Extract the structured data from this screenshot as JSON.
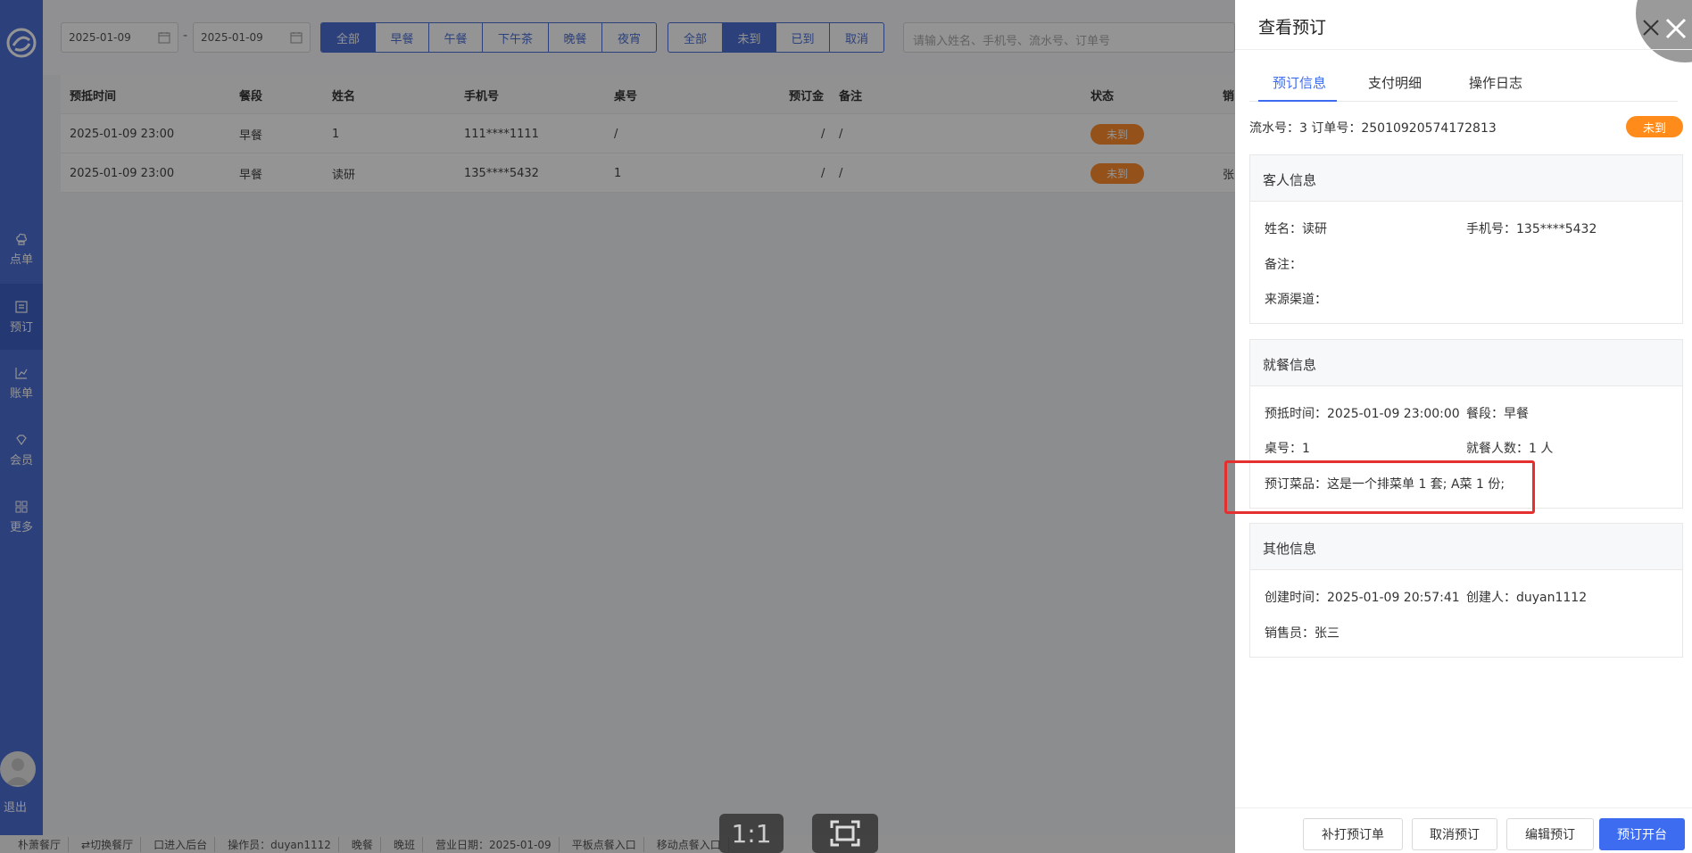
{
  "sidebar": {
    "items": [
      {
        "label": "点单",
        "icon": "chef-hat-icon"
      },
      {
        "label": "预订",
        "icon": "book-icon"
      },
      {
        "label": "账单",
        "icon": "chart-icon"
      },
      {
        "label": "会员",
        "icon": "diamond-icon"
      },
      {
        "label": "更多",
        "icon": "grid-icon"
      }
    ],
    "logout": "退出"
  },
  "filters": {
    "date_from": "2025-01-09",
    "date_sep": "-",
    "date_to": "2025-01-09",
    "meal_options": [
      "全部",
      "早餐",
      "午餐",
      "下午茶",
      "晚餐",
      "夜宵"
    ],
    "status_options": [
      "全部",
      "未到",
      "已到",
      "取消"
    ],
    "search_placeholder": "请输入姓名、手机号、流水号、订单号"
  },
  "table": {
    "headers": [
      "预抵时间",
      "餐段",
      "姓名",
      "手机号",
      "桌号",
      "预订金",
      "备注",
      "状态",
      "销"
    ],
    "rows": [
      {
        "time": "2025-01-09 23:00",
        "meal": "早餐",
        "name": "1",
        "phone": "111****1111",
        "table": "/",
        "deposit": "/",
        "note": "/",
        "status": "未到",
        "sales": ""
      },
      {
        "time": "2025-01-09 23:00",
        "meal": "早餐",
        "name": "读研",
        "phone": "135****5432",
        "table": "1",
        "deposit": "/",
        "note": "/",
        "status": "未到",
        "sales": "张"
      }
    ]
  },
  "bottombar": {
    "items": [
      "朴萧餐厅",
      "⇄切换餐厅",
      "口进入后台",
      "操作员：duyan1112",
      "晚餐",
      "晚班",
      "营业日期：2025-01-09",
      "平板点餐入口",
      "移动点餐入口"
    ]
  },
  "viewer": {
    "ratio_label": "1:1"
  },
  "drawer": {
    "title": "查看预订",
    "tabs": [
      "预订信息",
      "支付明细",
      "操作日志"
    ],
    "serial_line": "流水号：3  订单号：25010920574172813",
    "status": "未到",
    "guest": {
      "title": "客人信息",
      "name": "姓名：读研",
      "phone": "手机号：135****5432",
      "note": "备注：",
      "source": "来源渠道："
    },
    "dining": {
      "title": "就餐信息",
      "arrival": "预抵时间：2025-01-09 23:00:00",
      "meal": "餐段：早餐",
      "table": "桌号：1",
      "people": "就餐人数：1 人",
      "dishes": "预订菜品：这是一个排菜单 1 套; A菜 1 份;"
    },
    "other": {
      "title": "其他信息",
      "created": "创建时间：2025-01-09 20:57:41",
      "creator": "创建人：duyan1112",
      "sales": "销售员：张三"
    },
    "buttons": [
      "补打预订单",
      "取消预订",
      "编辑预订",
      "预订开台"
    ]
  },
  "colors": {
    "primary": "#3d6cf0",
    "sidebar": "#4c6fd6",
    "status_orange": "#ff8c1a",
    "highlight": "#e53030"
  }
}
